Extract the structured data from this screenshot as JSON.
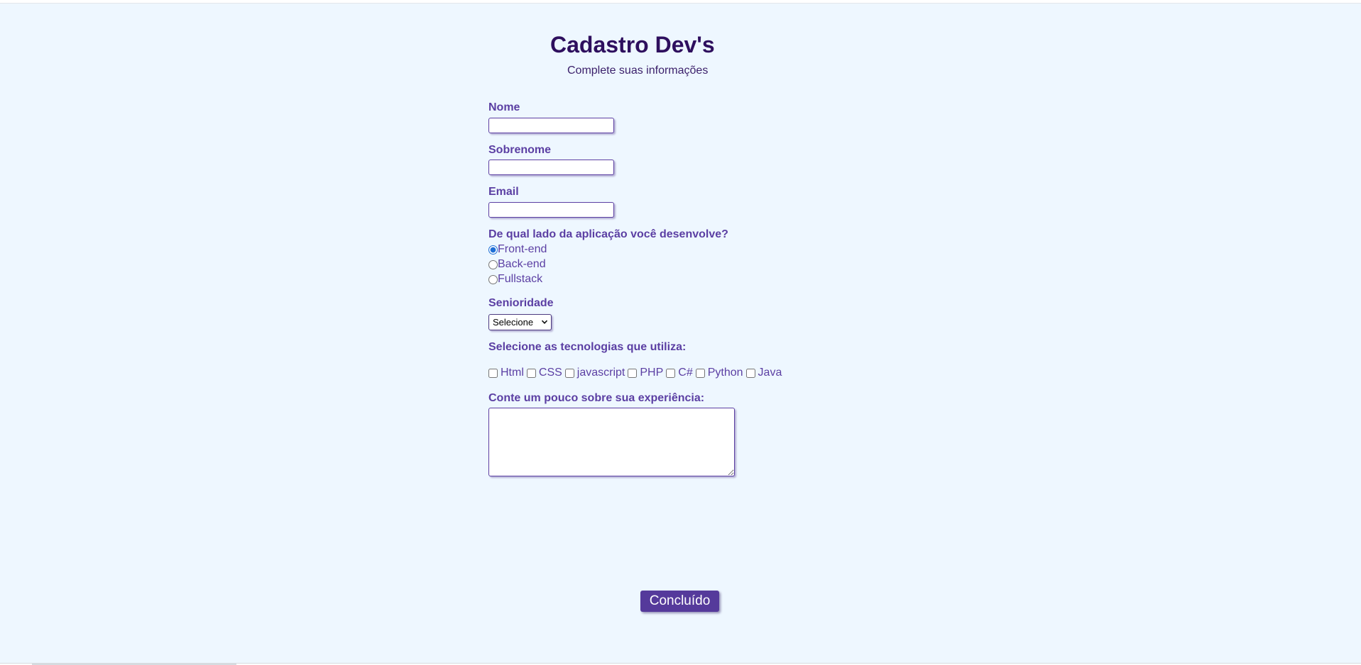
{
  "header": {
    "title": "Cadastro Dev's",
    "subtitle": "Complete suas informações"
  },
  "form": {
    "fields": {
      "nome_label": "Nome",
      "sobrenome_label": "Sobrenome",
      "email_label": "Email"
    },
    "side": {
      "question": "De qual lado da aplicação você desenvolve?",
      "options": [
        "Front-end",
        "Back-end",
        "Fullstack"
      ],
      "selected": "Front-end"
    },
    "seniority": {
      "label": "Senioridade",
      "selected": "Selecione"
    },
    "technologies": {
      "label": "Selecione as tecnologias que utiliza:",
      "options": [
        "Html",
        "CSS",
        "javascript",
        "PHP",
        "C#",
        "Python",
        "Java"
      ]
    },
    "experience": {
      "label": "Conte um pouco sobre sua experiência:"
    },
    "submit_label": "Concluído"
  },
  "colors": {
    "page_background": "#eef7ff",
    "title": "#2e0f5e",
    "label": "#5b3fa3",
    "button": "#553a9b"
  }
}
